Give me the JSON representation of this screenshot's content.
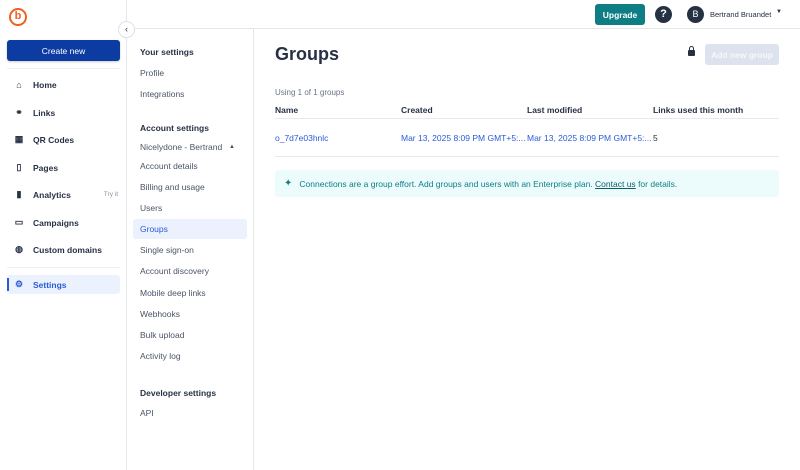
{
  "sidebar": {
    "create_label": "Create new",
    "items": [
      {
        "label": "Home",
        "icon": "home-icon"
      },
      {
        "label": "Links",
        "icon": "link-icon"
      },
      {
        "label": "QR Codes",
        "icon": "qr-code-icon"
      },
      {
        "label": "Pages",
        "icon": "page-icon"
      },
      {
        "label": "Analytics",
        "icon": "bar-chart-icon",
        "badge": "Try it"
      },
      {
        "label": "Campaigns",
        "icon": "folder-icon"
      },
      {
        "label": "Custom domains",
        "icon": "globe-icon"
      }
    ],
    "settings_label": "Settings"
  },
  "header": {
    "upgrade_label": "Upgrade",
    "avatar_initial": "B",
    "user_name": "Bertrand Bruandet"
  },
  "settings_nav": {
    "your_settings": "Your settings",
    "profile": "Profile",
    "integrations": "Integrations",
    "account_settings": "Account settings",
    "account_name": "Nicelydone - Bertrand",
    "account_items": [
      "Account details",
      "Billing and usage",
      "Users",
      "Groups",
      "Single sign-on",
      "Account discovery",
      "Mobile deep links",
      "Webhooks",
      "Bulk upload",
      "Activity log"
    ],
    "developer_settings": "Developer settings",
    "api": "API"
  },
  "main": {
    "title": "Groups",
    "add_label": "Add new group",
    "usage": "Using 1 of 1 groups",
    "columns": [
      "Name",
      "Created",
      "Last modified",
      "Links used this month"
    ],
    "rows": [
      {
        "name": "o_7d7e03hnlc",
        "created": "Mar 13, 2025 8:09 PM GMT+5:...",
        "modified": "Mar 13, 2025 8:09 PM GMT+5:...",
        "links": "5"
      }
    ],
    "banner": {
      "text": "Connections are a group effort. Add groups and users with an Enterprise plan.",
      "link": "Contact us",
      "suffix": "for details."
    }
  },
  "colors": {
    "brand": "#ee6123",
    "primary": "#0c3ba1",
    "upgrade": "#0f7e84",
    "link": "#2a5bd7",
    "banner_bg": "#ecfbfc"
  }
}
